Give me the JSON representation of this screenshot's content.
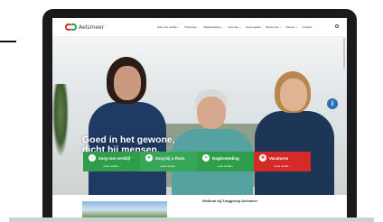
{
  "logo": {
    "name": "Aelsmeer"
  },
  "nav": {
    "items": [
      "Zorg met verblijf ⌄",
      "Thuiszorg ⌄",
      "Dagbesteding ⌄",
      "Voor wie ⌄",
      "Zorg regelen",
      "Werken bij ⌄",
      "Nieuws ⌄",
      "Contact"
    ]
  },
  "hero": {
    "title_line1": "Goed in het gewone,",
    "title_line2": "dicht bij mensen."
  },
  "side_button": {
    "glyph": "i",
    "icon": "info-icon"
  },
  "tiles": [
    {
      "label": "Zorg met verblijf",
      "more": "Lees verder ›",
      "icon": "house-icon",
      "color": "#2e9e4b"
    },
    {
      "label": "Zorg bij u thuis",
      "more": "Lees verder ›",
      "icon": "home-care-icon",
      "color": "#37a659"
    },
    {
      "label": "Dagbesteding",
      "more": "Lees verder ›",
      "icon": "sun-icon",
      "color": "#2e9e4b"
    },
    {
      "label": "Vacatures",
      "more": "Lees verder ›",
      "icon": "briefcase-icon",
      "color": "#d52a27"
    }
  ],
  "welcome": "Welkom bij Zorggroep Aelsmeer",
  "colors": {
    "brand_green": "#2e9e4b",
    "brand_red": "#d52a27",
    "nurse_uniform": "#1f3a63",
    "frame": "#1a1a1c"
  }
}
